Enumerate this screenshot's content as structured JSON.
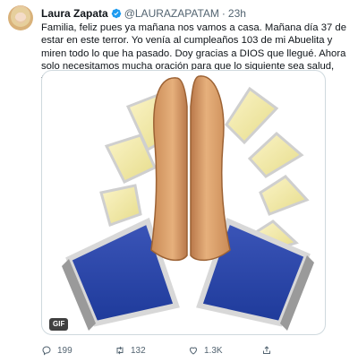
{
  "author": {
    "name": "Laura Zapata",
    "handle": "@LAURAZAPATAM",
    "separator": "·",
    "time": "23h"
  },
  "tweet": {
    "text": "Familia, feliz pues ya mañana nos vamos a casa. Mañana día 37 de estar en este terror. Yo venía al cumpleaños 103 de mi Abuelita y miren todo lo que ha pasado. Doy gracias a DIOS que llegué. Ahora solo necesitamos mucha oración para que lo siguiente sea salud, felicidad y amor",
    "heart": "❤"
  },
  "media": {
    "badge": "GIF"
  },
  "actions": {
    "replies": "199",
    "retweets": "132",
    "likes": "1.3K"
  },
  "colors": {
    "verified": "#1d9bf0",
    "heart": "#e0245e",
    "meta": "#536471"
  },
  "icons": [
    "verified-badge-icon",
    "reply-icon",
    "retweet-icon",
    "like-icon",
    "share-icon"
  ]
}
